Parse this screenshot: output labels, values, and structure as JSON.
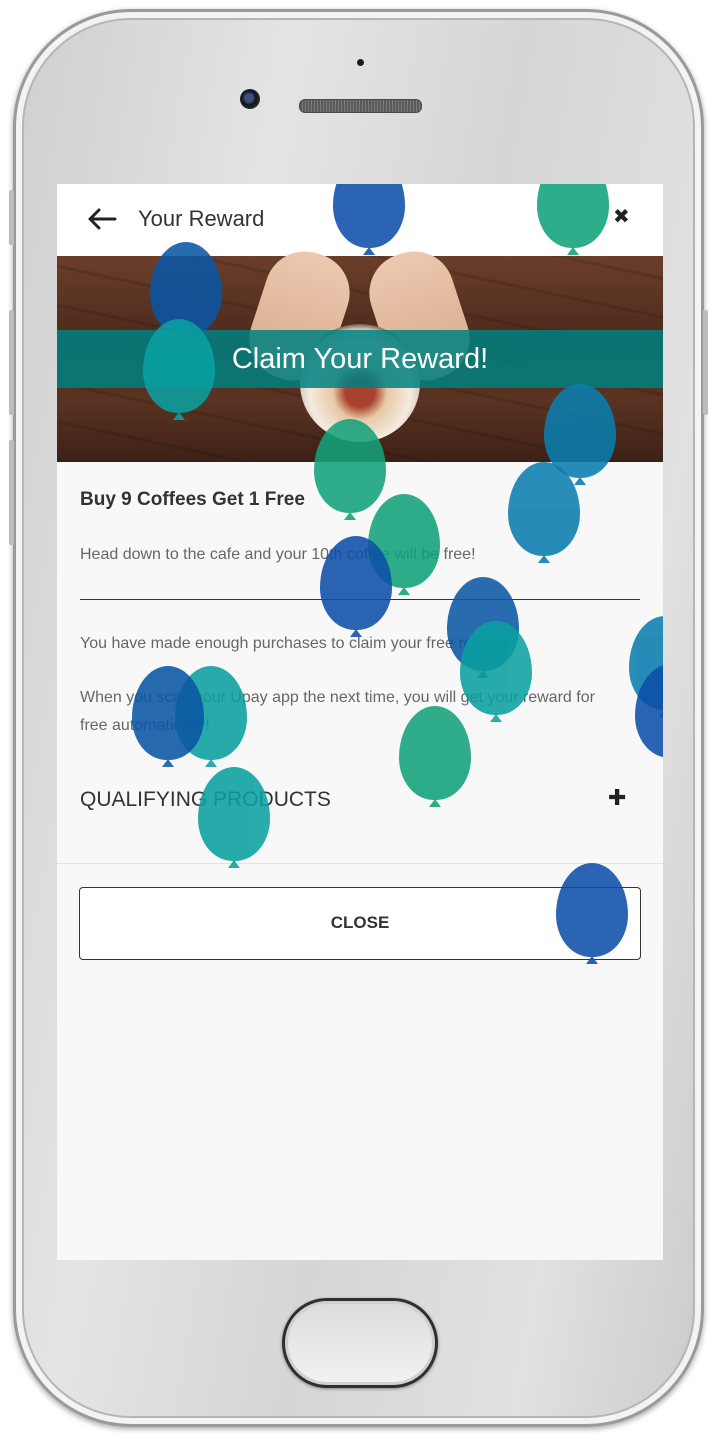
{
  "header": {
    "title": "Your Reward",
    "back_icon": "arrow-left-icon",
    "close_icon": "close-x-icon"
  },
  "banner": {
    "title": "Claim Your Reward!"
  },
  "reward": {
    "heading": "Buy 9 Coffees Get 1 Free",
    "description": "Head down to the cafe and your 10th coffee will be free!"
  },
  "info": {
    "line1": "You have made enough purchases to claim your free reward!",
    "line2": "When you scan your Upay app the next time, you will get your reward for free automatically!"
  },
  "qualifying": {
    "label": "QUALIFYING PRODUCTS",
    "expand_icon": "plus-icon"
  },
  "actions": {
    "close_label": "CLOSE"
  },
  "colors": {
    "banner_strip": "#008080",
    "balloon_blue": "#0d4fa8",
    "balloon_green": "#12a27a",
    "balloon_teal": "#0aa0a0"
  }
}
